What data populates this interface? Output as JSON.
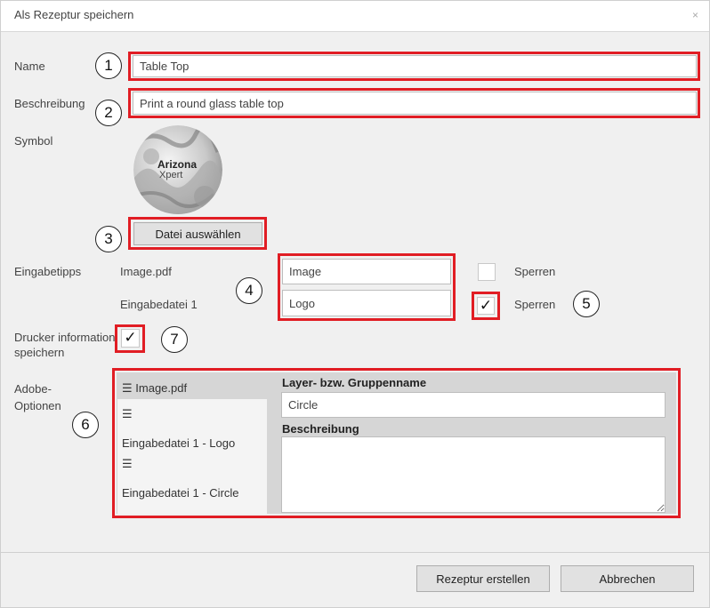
{
  "window": {
    "title": "Als Rezeptur speichern",
    "close_glyph": "×"
  },
  "fields": {
    "name_label": "Name",
    "name_value": "Table Top",
    "description_label": "Beschreibung",
    "description_value": "Print a round glass table top",
    "symbol_label": "Symbol",
    "logo_line1": "Arizona",
    "logo_line2": "Xpert",
    "choose_file_button": "Datei auswählen"
  },
  "input_hints": {
    "label": "Eingabetipps",
    "rows": [
      {
        "name": "Image.pdf",
        "value": "Image",
        "lock_label": "Sperren",
        "locked": false
      },
      {
        "name": "Eingabedatei 1",
        "value": "Logo",
        "lock_label": "Sperren",
        "locked": true
      }
    ]
  },
  "printer_info": {
    "label_line1": "Drucker information",
    "label_line2": "speichern",
    "checked": true,
    "check_glyph": "✓"
  },
  "adobe_options": {
    "label_line1": "Adobe-",
    "label_line2": "Optionen",
    "tree": [
      {
        "glyph": "☰",
        "text": "Image.pdf"
      },
      {
        "glyph": "☰",
        "text": ""
      },
      {
        "glyph": "",
        "text": "Eingabedatei 1 - Logo"
      },
      {
        "glyph": "☰",
        "text": ""
      },
      {
        "glyph": "",
        "text": "Eingabedatei 1 - Circle"
      }
    ],
    "layer_label": "Layer- bzw. Gruppenname",
    "layer_value": "Circle",
    "description_label": "Beschreibung",
    "description_value": ""
  },
  "callouts": [
    "1",
    "2",
    "3",
    "4",
    "5",
    "6",
    "7"
  ],
  "footer": {
    "create_button": "Rezeptur erstellen",
    "cancel_button": "Abbrechen"
  },
  "colors": {
    "highlight": "#e11d24",
    "dialog_bg": "#f0f0f0",
    "list_selected": "#d6d6d6"
  }
}
